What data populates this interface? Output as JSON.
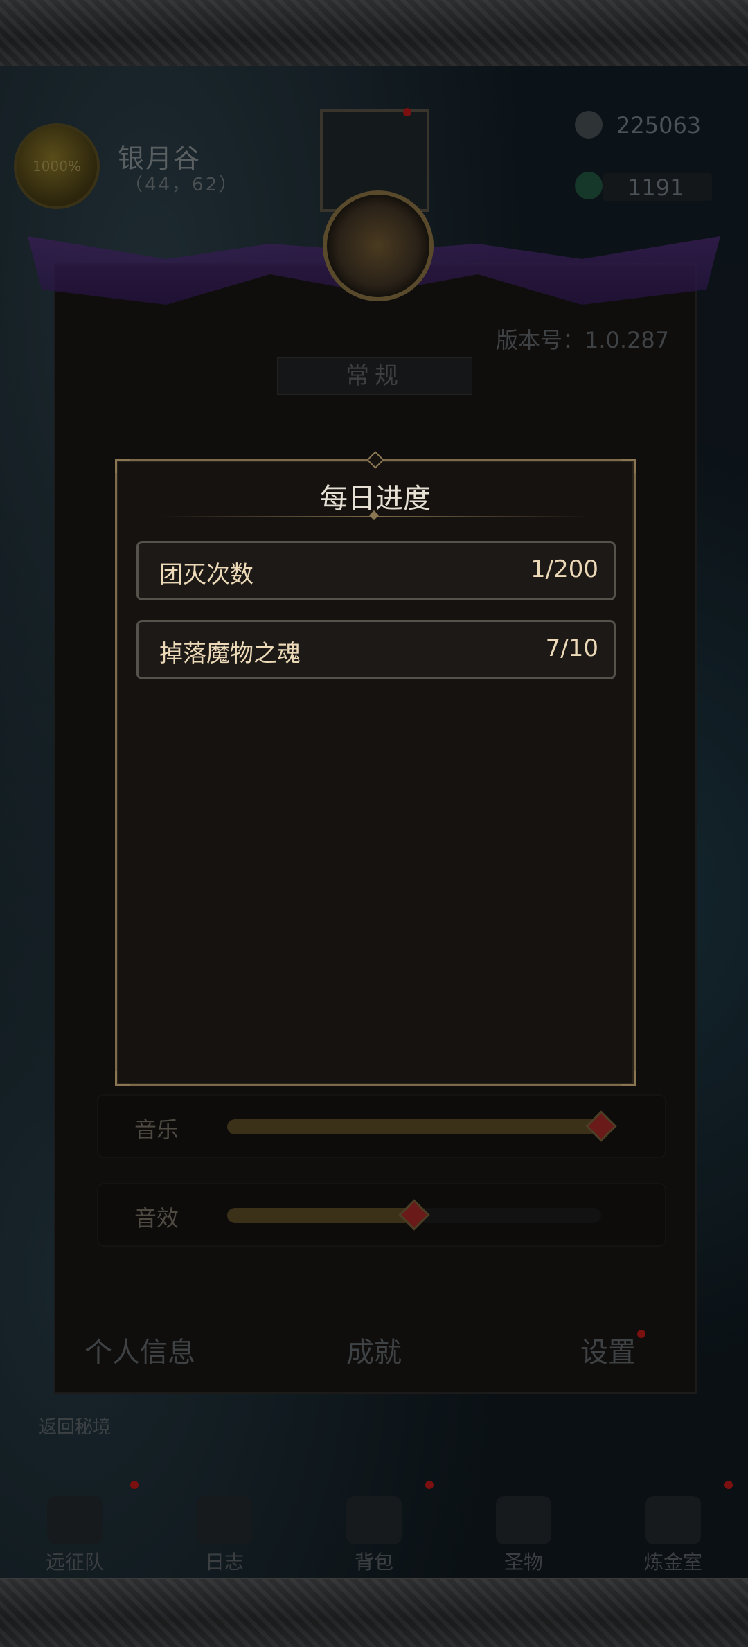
{
  "hud": {
    "coin_text": "1000%",
    "location_name": "银月谷",
    "location_coords": "（44，62）",
    "resource_1": "225063",
    "resource_2": "1191"
  },
  "settings": {
    "version_text": "版本号：1.0.287",
    "section_tab": "常规",
    "music_label": "音乐",
    "music_level": 1.0,
    "sfx_label": "音效",
    "sfx_level": 0.5,
    "bottom_tabs": [
      "个人信息",
      "成就",
      "设置"
    ],
    "return_text": "返回秘境"
  },
  "bottom_nav": [
    {
      "label": "远征队",
      "icon": "helmet-icon"
    },
    {
      "label": "日志",
      "icon": "scroll-icon"
    },
    {
      "label": "背包",
      "icon": "bag-icon"
    },
    {
      "label": "圣物",
      "icon": "relic-icon"
    },
    {
      "label": "炼金室",
      "icon": "alchemy-icon"
    }
  ],
  "modal": {
    "title": "每日进度",
    "rows": [
      {
        "label": "团灭次数",
        "value": "1/200"
      },
      {
        "label": "掉落魔物之魂",
        "value": "7/10"
      }
    ]
  },
  "colors": {
    "modal_border": "#7c6a4a",
    "row_text": "#ecd9b8",
    "title_text": "#e6e0d4",
    "notification_dot": "#b01818"
  }
}
